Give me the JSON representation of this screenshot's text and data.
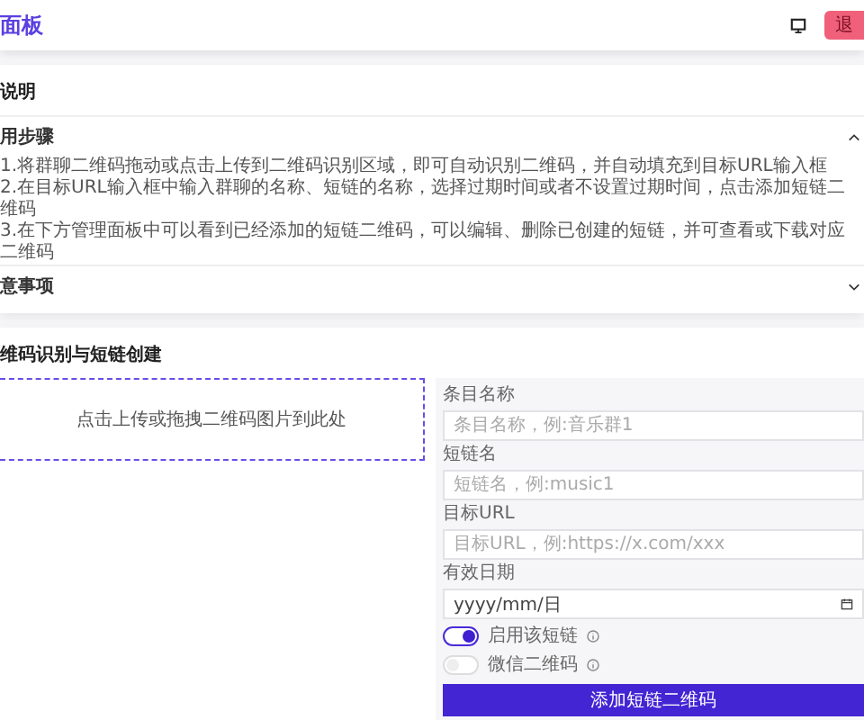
{
  "header": {
    "title": "面板",
    "logout_button": "退"
  },
  "guide": {
    "title": "说明",
    "sections": [
      {
        "title": "用步骤",
        "expanded": true,
        "lines": [
          "1.将群聊二维码拖动或点击上传到二维码识别区域，即可自动识别二维码，并自动填充到目标URL输入框",
          "2.在目标URL输入框中输入群聊的名称、短链的名称，选择过期时间或者不设置过期时间，点击添加短链二维码",
          "3.在下方管理面板中可以看到已经添加的短链二维码，可以编辑、删除已创建的短链，并可查看或下载对应二维码"
        ]
      },
      {
        "title": "意事项",
        "expanded": false
      }
    ]
  },
  "creator": {
    "title": "维码识别与短链创建",
    "upload_hint": "点击上传或拖拽二维码图片到此处",
    "fields": [
      {
        "kind": "text",
        "label": "条目名称",
        "placeholder": "条目名称，例:音乐群1"
      },
      {
        "kind": "text",
        "label": "短链名",
        "placeholder": "短链名，例:music1"
      },
      {
        "kind": "text",
        "label": "目标URL",
        "placeholder": "目标URL，例:https://x.com/xxx"
      },
      {
        "kind": "date",
        "label": "有效日期",
        "placeholder": "yyyy/mm/日"
      }
    ],
    "toggles": [
      {
        "label": "启用该短链",
        "on": true
      },
      {
        "label": "微信二维码",
        "on": false
      }
    ],
    "submit": "添加短链二维码"
  }
}
